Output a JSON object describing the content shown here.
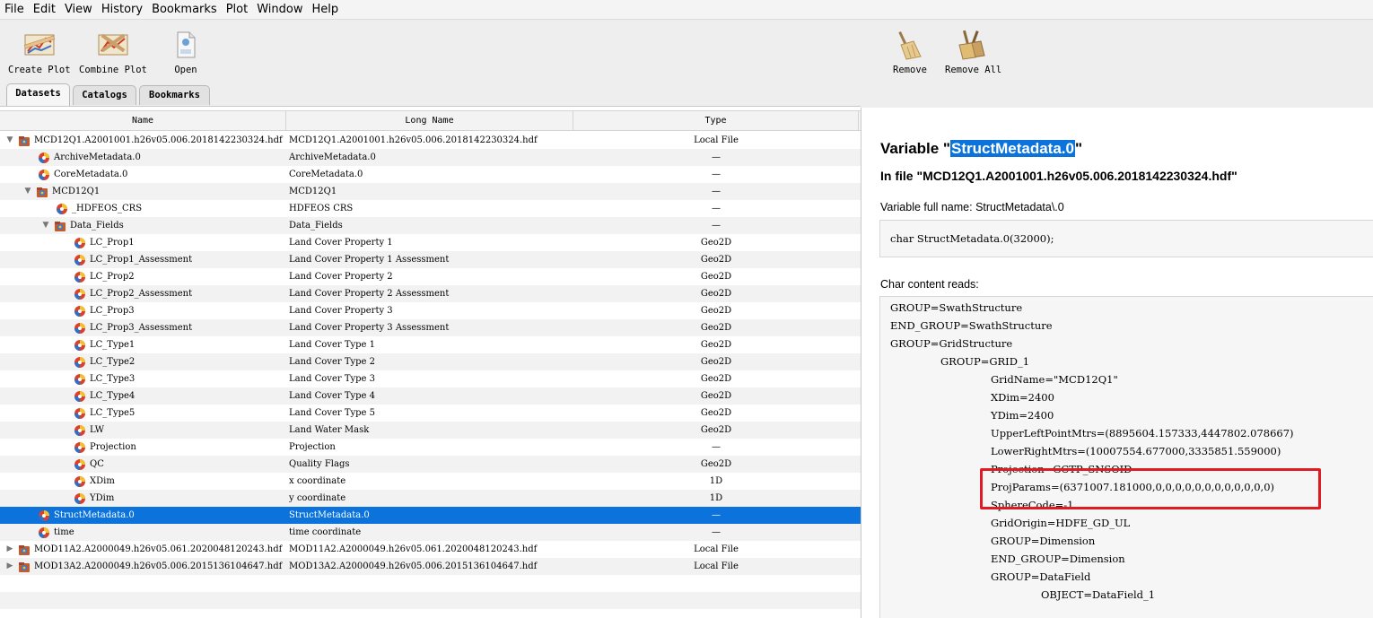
{
  "menu": [
    "File",
    "Edit",
    "View",
    "History",
    "Bookmarks",
    "Plot",
    "Window",
    "Help"
  ],
  "toolbar": {
    "create_plot": "Create Plot",
    "combine_plot": "Combine Plot",
    "open": "Open",
    "remove": "Remove",
    "remove_all": "Remove All"
  },
  "tabs": [
    "Datasets",
    "Catalogs",
    "Bookmarks"
  ],
  "columns": {
    "name": "Name",
    "long_name": "Long Name",
    "type": "Type"
  },
  "rows": [
    {
      "name": "MCD12Q1.A2001001.h26v05.006.2018142230324.hdf",
      "long": "MCD12Q1.A2001001.h26v05.006.2018142230324.hdf",
      "type": "Local File"
    },
    {
      "name": "ArchiveMetadata.0",
      "long": "ArchiveMetadata.0",
      "type": "—"
    },
    {
      "name": "CoreMetadata.0",
      "long": "CoreMetadata.0",
      "type": "—"
    },
    {
      "name": "MCD12Q1",
      "long": "MCD12Q1",
      "type": "—"
    },
    {
      "name": "_HDFEOS_CRS",
      "long": " HDFEOS CRS",
      "type": "—"
    },
    {
      "name": "Data_Fields",
      "long": "Data_Fields",
      "type": "—"
    },
    {
      "name": "LC_Prop1",
      "long": "Land Cover Property 1",
      "type": "Geo2D"
    },
    {
      "name": "LC_Prop1_Assessment",
      "long": "Land Cover Property 1 Assessment",
      "type": "Geo2D"
    },
    {
      "name": "LC_Prop2",
      "long": "Land Cover Property 2",
      "type": "Geo2D"
    },
    {
      "name": "LC_Prop2_Assessment",
      "long": "Land Cover Property 2 Assessment",
      "type": "Geo2D"
    },
    {
      "name": "LC_Prop3",
      "long": "Land Cover Property 3",
      "type": "Geo2D"
    },
    {
      "name": "LC_Prop3_Assessment",
      "long": "Land Cover Property 3 Assessment",
      "type": "Geo2D"
    },
    {
      "name": "LC_Type1",
      "long": "Land Cover Type 1",
      "type": "Geo2D"
    },
    {
      "name": "LC_Type2",
      "long": "Land Cover Type 2",
      "type": "Geo2D"
    },
    {
      "name": "LC_Type3",
      "long": "Land Cover Type 3",
      "type": "Geo2D"
    },
    {
      "name": "LC_Type4",
      "long": "Land Cover Type 4",
      "type": "Geo2D"
    },
    {
      "name": "LC_Type5",
      "long": "Land Cover Type 5",
      "type": "Geo2D"
    },
    {
      "name": "LW",
      "long": "Land Water Mask",
      "type": "Geo2D"
    },
    {
      "name": "Projection",
      "long": "Projection",
      "type": "—"
    },
    {
      "name": "QC",
      "long": "Quality Flags",
      "type": "Geo2D"
    },
    {
      "name": "XDim",
      "long": "x coordinate",
      "type": "1D"
    },
    {
      "name": "YDim",
      "long": "y coordinate",
      "type": "1D"
    },
    {
      "name": "StructMetadata.0",
      "long": "StructMetadata.0",
      "type": "—"
    },
    {
      "name": "time",
      "long": "time coordinate",
      "type": "—"
    },
    {
      "name": "MOD11A2.A2000049.h26v05.061.2020048120243.hdf",
      "long": "MOD11A2.A2000049.h26v05.061.2020048120243.hdf",
      "type": "Local File"
    },
    {
      "name": "MOD13A2.A2000049.h26v05.006.2015136104647.hdf",
      "long": "MOD13A2.A2000049.h26v05.006.2015136104647.hdf",
      "type": "Local File"
    }
  ],
  "detail": {
    "title_prefix": "Variable \"",
    "title_var": "StructMetadata.0",
    "title_suffix": "\"",
    "in_file": "In file \"MCD12Q1.A2001001.h26v05.006.2018142230324.hdf\"",
    "full_name": "Variable full name: StructMetadata\\.0",
    "declaration": "char StructMetadata.0(32000);",
    "char_label": "Char content reads:",
    "content_lines": [
      "GROUP=SwathStructure",
      "END_GROUP=SwathStructure",
      "GROUP=GridStructure",
      "GROUP=GRID_1",
      "GridName=\"MCD12Q1\"",
      "XDim=2400",
      "YDim=2400",
      "UpperLeftPointMtrs=(8895604.157333,4447802.078667)",
      "LowerRightMtrs=(10007554.677000,3335851.559000)",
      "Projection=GCTP_SNSOID",
      "ProjParams=(6371007.181000,0,0,0,0,0,0,0,0,0,0,0,0)",
      "SphereCode=-1",
      "GridOrigin=HDFE_GD_UL",
      "GROUP=Dimension",
      "END_GROUP=Dimension",
      "GROUP=DataField",
      "OBJECT=DataField_1"
    ]
  },
  "colors": {
    "selection": "#0b73db",
    "highlight_box": "#e01b24"
  }
}
